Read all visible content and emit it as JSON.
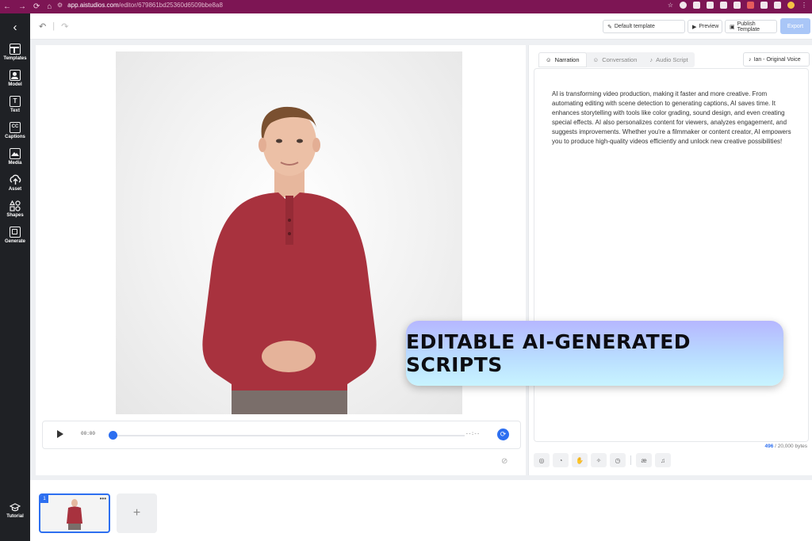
{
  "browser": {
    "url_host": "app.aistudios.com",
    "url_path": "/editor/679861bd25360d6509bbe8a8"
  },
  "sidebar": {
    "items": [
      {
        "label": "Templates",
        "icon": "templates-icon"
      },
      {
        "label": "Model",
        "icon": "model-icon"
      },
      {
        "label": "Text",
        "icon": "text-icon"
      },
      {
        "label": "Captions",
        "icon": "captions-icon"
      },
      {
        "label": "Media",
        "icon": "media-icon"
      },
      {
        "label": "Asset",
        "icon": "upload-icon"
      },
      {
        "label": "Shapes",
        "icon": "shapes-icon"
      },
      {
        "label": "Generate",
        "icon": "generate-icon"
      }
    ],
    "tutorial_label": "Tutorial"
  },
  "toolbar": {
    "template_label": "Default template",
    "preview_label": "Preview",
    "publish_label": "Publish Template",
    "export_label": "Export"
  },
  "player": {
    "time_current": "00:00",
    "time_total": "--:--"
  },
  "script": {
    "tabs": [
      {
        "label": "Narration",
        "active": true
      },
      {
        "label": "Conversation",
        "active": false
      },
      {
        "label": "Audio Script",
        "active": false
      }
    ],
    "voice_label": "Ian - Original Voice",
    "text": "AI is transforming video production, making it faster and more creative. From automating editing with scene detection to generating captions, AI saves time. It enhances storytelling with tools like color grading, sound design, and even creating special effects. AI also personalizes content for viewers, analyzes engagement, and suggests improvements. Whether you're a filmmaker or content creator, AI empowers you to produce high-quality videos efficiently and unlock new creative possibilities!",
    "bytes_used": "496",
    "bytes_limit": "/ 20,000 bytes"
  },
  "banner": {
    "text": "EDITABLE AI-GENERATED SCRIPTS"
  },
  "scenes": {
    "items": [
      {
        "number": "1"
      }
    ]
  },
  "colors": {
    "accent": "#2d6ff0",
    "browser_bar": "#7d1554",
    "sidebar": "#1f2125",
    "shirt": "#a8323e"
  }
}
